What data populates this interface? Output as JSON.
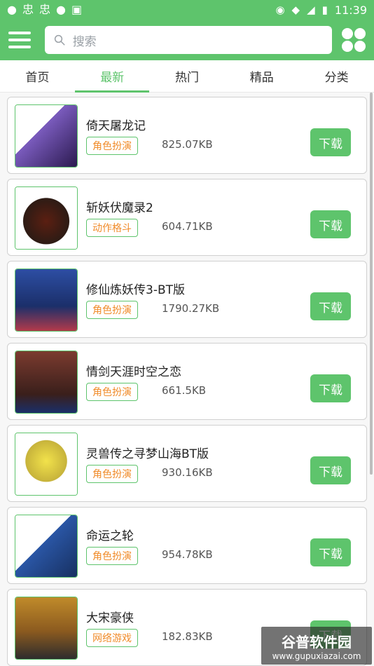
{
  "status_bar": {
    "time": "11:39",
    "icons": [
      "status-dot-icon",
      "bug-icon",
      "bug-icon",
      "status-dot-icon",
      "image-icon",
      "location-icon",
      "wifi-icon",
      "signal-icon",
      "battery-icon"
    ]
  },
  "search": {
    "placeholder": "搜索"
  },
  "tabs": [
    {
      "label": "首页",
      "active": false
    },
    {
      "label": "最新",
      "active": true
    },
    {
      "label": "热门",
      "active": false
    },
    {
      "label": "精品",
      "active": false
    },
    {
      "label": "分类",
      "active": false
    }
  ],
  "apps": [
    {
      "title": "倚天屠龙记",
      "tag": "角色扮演",
      "size": "825.07KB",
      "button": "下载",
      "thumb_color": "#7a5bbd"
    },
    {
      "title": "斩妖伏魔录2",
      "tag": "动作格斗",
      "size": "604.71KB",
      "button": "下载",
      "thumb_color": "#2d1b14"
    },
    {
      "title": "修仙炼妖传3-BT版",
      "tag": "角色扮演",
      "size": "1790.27KB",
      "button": "下载",
      "thumb_color": "#2d4ea3"
    },
    {
      "title": "情剑天涯时空之恋",
      "tag": "角色扮演",
      "size": "661.5KB",
      "button": "下载",
      "thumb_color": "#7b3b2f"
    },
    {
      "title": "灵兽传之寻梦山海BT版",
      "tag": "角色扮演",
      "size": "930.16KB",
      "button": "下载",
      "thumb_color": "#c7b33b"
    },
    {
      "title": "命运之轮",
      "tag": "角色扮演",
      "size": "954.78KB",
      "button": "下载",
      "thumb_color": "#2a56a5"
    },
    {
      "title": "大宋豪侠",
      "tag": "网络游戏",
      "size": "182.83KB",
      "button": "下载",
      "thumb_color": "#c08b2a"
    }
  ],
  "watermark": {
    "text": "谷普软件园",
    "url": "www.gupuxiazai.com"
  },
  "colors": {
    "accent": "#5ec46c",
    "tag_text": "#f08c2b"
  }
}
